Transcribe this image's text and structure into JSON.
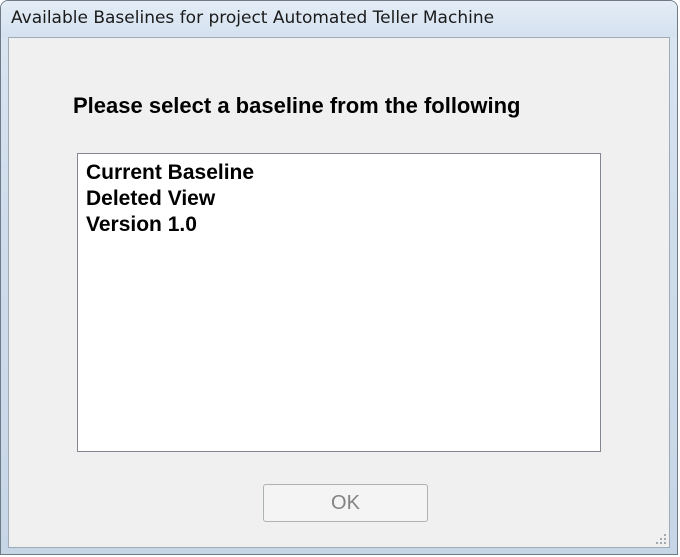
{
  "window": {
    "title": "Available Baselines for project Automated Teller Machine"
  },
  "dialog": {
    "prompt": "Please select a baseline from the following",
    "baselines": [
      "Current Baseline",
      "Deleted View",
      "Version 1.0"
    ],
    "ok_label": "OK",
    "ok_enabled": false
  },
  "icons": {
    "resize_grip": "resize-grip-icon"
  }
}
